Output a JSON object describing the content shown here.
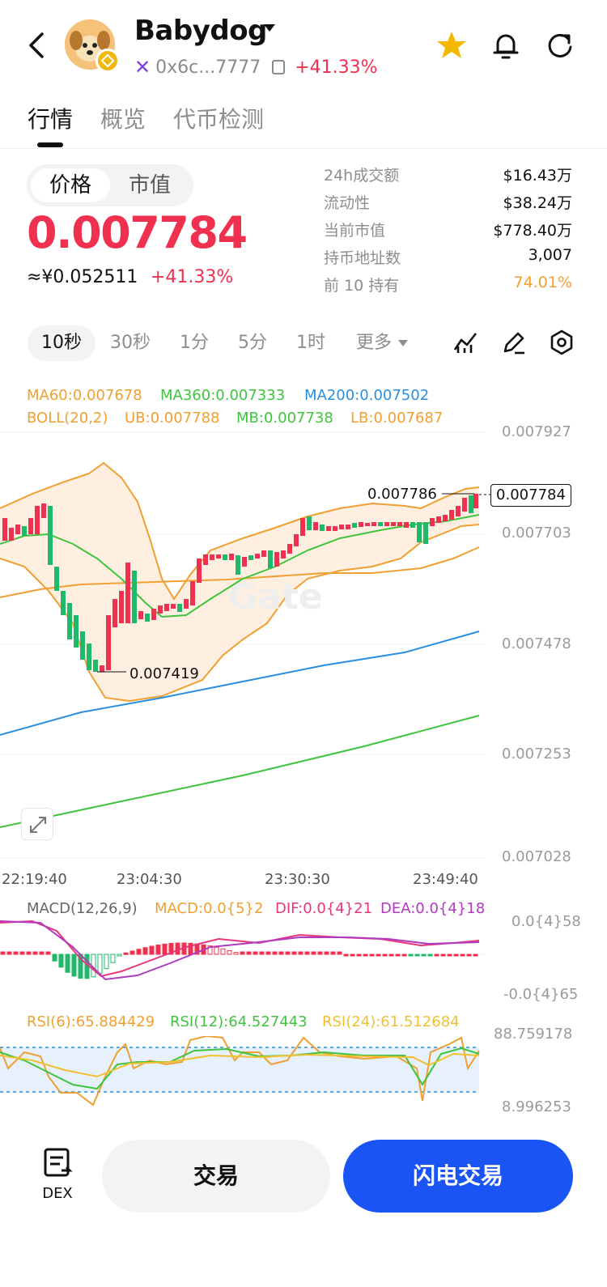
{
  "header": {
    "token_name": "Babydog",
    "address": "0x6c...7777",
    "change": "+41.33%",
    "chain_icon": "multichain-x-icon"
  },
  "tabs": [
    {
      "label": "行情",
      "active": true
    },
    {
      "label": "概览",
      "active": false
    },
    {
      "label": "代币检测",
      "active": false
    }
  ],
  "price_panel": {
    "toggle": [
      "价格",
      "市值"
    ],
    "price": "0.007784",
    "cny": "≈¥0.052511",
    "change": "+41.33%"
  },
  "stats": [
    {
      "label": "24h成交额",
      "value": "$16.43万"
    },
    {
      "label": "流动性",
      "value": "$38.24万"
    },
    {
      "label": "当前市值",
      "value": "$778.40万"
    },
    {
      "label": "持币地址数",
      "value": "3,007"
    },
    {
      "label": "前 10 持有",
      "value": "74.01%"
    }
  ],
  "intervals": [
    "10秒",
    "30秒",
    "1分",
    "5分",
    "1时",
    "更多"
  ],
  "main_chart": {
    "legend_ma": [
      "MA60:0.007678",
      "MA360:0.007333",
      "MA200:0.007502"
    ],
    "legend_boll": [
      "BOLL(20,2)",
      "UB:0.007788",
      "MB:0.007738",
      "LB:0.007687"
    ],
    "y_labels": [
      "0.007927",
      "0.007703",
      "0.007478",
      "0.007253",
      "0.007028"
    ],
    "x_labels": [
      "22:19:40",
      "23:04:30",
      "23:30:30",
      "23:49:40"
    ],
    "current_price_tag": "0.007784",
    "high_label": "0.007786",
    "low_label": "0.007419",
    "watermark": "Gate"
  },
  "macd": {
    "legend": [
      "MACD(12,26,9)",
      "MACD:0.0{5}2",
      "DIF:0.0{4}21",
      "DEA:0.0{4}18"
    ],
    "y_labels": [
      "0.0{4}58",
      "-0.0{4}65"
    ]
  },
  "rsi": {
    "legend": [
      "RSI(6):65.884429",
      "RSI(12):64.527443",
      "RSI(24):61.512684"
    ],
    "y_labels": [
      "88.759178",
      "8.996253"
    ]
  },
  "bottom": {
    "dex_label": "DEX",
    "trade_label": "交易",
    "flash_label": "闪电交易"
  },
  "colors": {
    "up": "#f0304f",
    "down": "#1fb96b",
    "accent_blue": "#1a54f5",
    "orange": "#f0a030"
  }
}
